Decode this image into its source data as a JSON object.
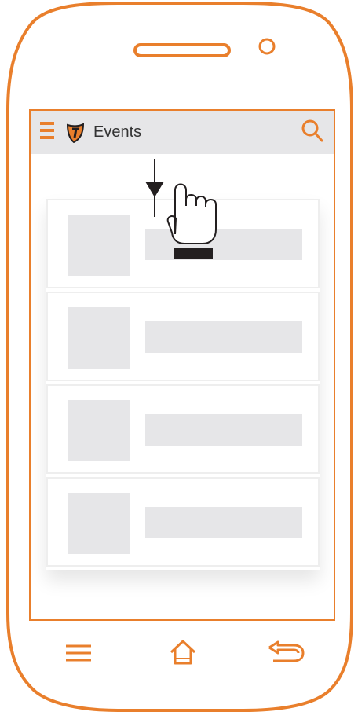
{
  "app_bar": {
    "title": "Events",
    "menu_icon": "hamburger-menu-icon",
    "logo_icon": "shield-logo-icon",
    "search_icon": "search-icon"
  },
  "event_list": {
    "item_count": 4,
    "items": [
      {
        "placeholder": true
      },
      {
        "placeholder": true
      },
      {
        "placeholder": true
      },
      {
        "placeholder": true
      }
    ]
  },
  "gesture": {
    "type": "pull-down",
    "icons": [
      "down-arrow-icon",
      "hand-pointer-icon"
    ]
  },
  "nav_bar": {
    "icons": [
      "menu-lines-icon",
      "home-icon",
      "back-icon"
    ]
  },
  "colors": {
    "accent": "#e97f2c",
    "placeholder": "#e6e6e8",
    "app_bar_bg": "#e6e6e8",
    "gesture": "#231f20"
  }
}
